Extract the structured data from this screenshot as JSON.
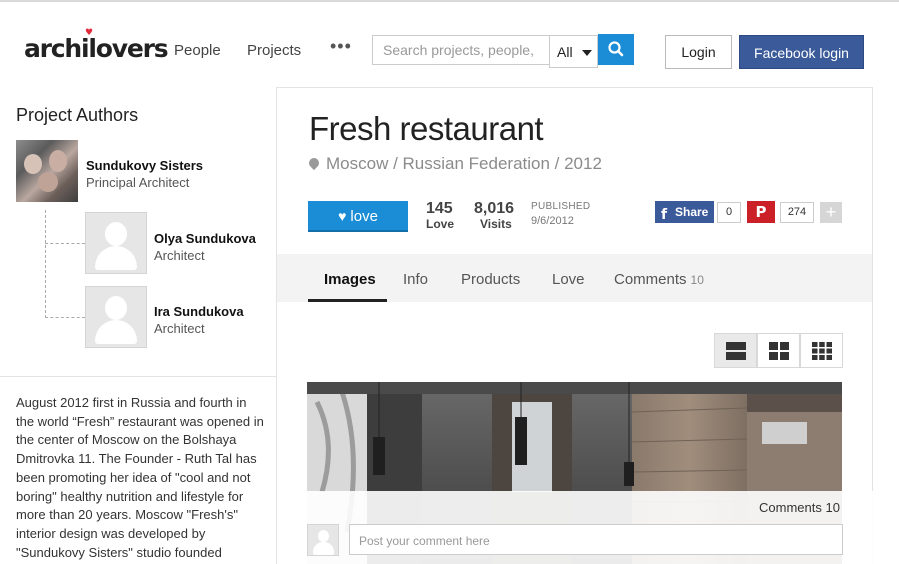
{
  "header": {
    "logo": "archilovers",
    "nav": {
      "people": "People",
      "projects": "Projects",
      "more": "•••"
    },
    "search": {
      "placeholder": "Search projects, people,",
      "filter_value": "All"
    },
    "login": "Login",
    "facebook_login": "Facebook login"
  },
  "sidebar": {
    "title": "Project Authors",
    "authors": [
      {
        "name": "Sundukovy Sisters",
        "role": "Principal Architect"
      },
      {
        "name": "Olya Sundukova",
        "role": "Architect"
      },
      {
        "name": "Ira Sundukova",
        "role": "Architect"
      }
    ],
    "description": "August 2012 first in Russia and fourth in the world “Fresh” restaurant was opened in the center of Moscow on the Bolshaya Dmitrovka 11. The Founder - Ruth Tal has been promoting her idea of \"cool and not boring\" healthy nutrition and lifestyle for more than 20 years. Moscow \"Fresh's\" interior design was developed by \"Sundukovy Sisters\" studio founded"
  },
  "project": {
    "title": "Fresh restaurant",
    "location": "Moscow / Russian Federation / 2012",
    "love_button": "love",
    "love_count": "145",
    "love_label": "Love",
    "visits_count": "8,016",
    "visits_label": "Visits",
    "published_label": "PUBLISHED",
    "published_date": "9/6/2012",
    "share": {
      "facebook_label": "Share",
      "facebook_count": "0",
      "pinterest_count": "274",
      "plus": "+"
    }
  },
  "tabs": [
    {
      "label": "Images"
    },
    {
      "label": "Info"
    },
    {
      "label": "Products"
    },
    {
      "label": "Love"
    },
    {
      "label": "Comments",
      "count": "10"
    }
  ],
  "comments": {
    "label": "Comments 10",
    "placeholder": "Post your comment here"
  },
  "colors": {
    "accent": "#1a8dd6",
    "facebook": "#3b5a9a",
    "pinterest": "#cb2027",
    "logo_heart": "#e02a3a"
  },
  "icons": [
    "search-icon",
    "map-pin-icon",
    "heart-icon",
    "facebook-icon",
    "pinterest-icon",
    "view-large-icon",
    "view-grid-4-icon",
    "view-grid-9-icon"
  ]
}
